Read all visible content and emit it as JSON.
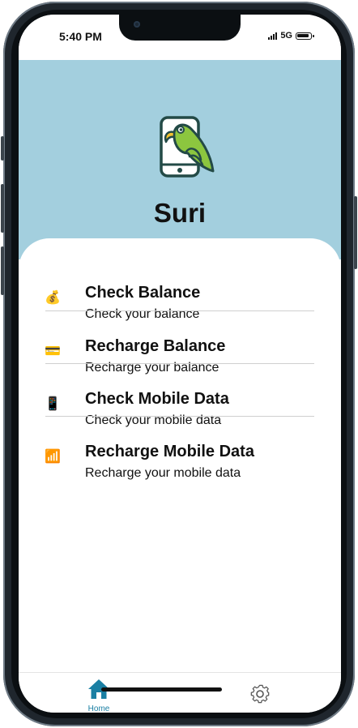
{
  "status_bar": {
    "time": "5:40 PM",
    "network": "5G"
  },
  "app": {
    "title": "Suri",
    "logo_icon": "parrot-phone-logo"
  },
  "menu": [
    {
      "icon": "money-bag-icon",
      "glyph": "💰",
      "title": "Check Balance",
      "subtitle": "Check your balance"
    },
    {
      "icon": "credit-card-icon",
      "glyph": "💳",
      "title": "Recharge Balance",
      "subtitle": "Recharge your balance"
    },
    {
      "icon": "mobile-phone-icon",
      "glyph": "📱",
      "title": "Check Mobile Data",
      "subtitle": "Check your mobile data"
    },
    {
      "icon": "signal-bars-icon",
      "glyph": "📶",
      "title": "Recharge Mobile Data",
      "subtitle": "Recharge your mobile data"
    }
  ],
  "bottom_nav": {
    "home": {
      "label": "Home",
      "icon": "home-icon"
    },
    "settings": {
      "icon": "gear-icon"
    }
  },
  "colors": {
    "header_bg": "#a3cfde",
    "accent": "#1a7fa3",
    "parrot": "#8cc63f"
  }
}
